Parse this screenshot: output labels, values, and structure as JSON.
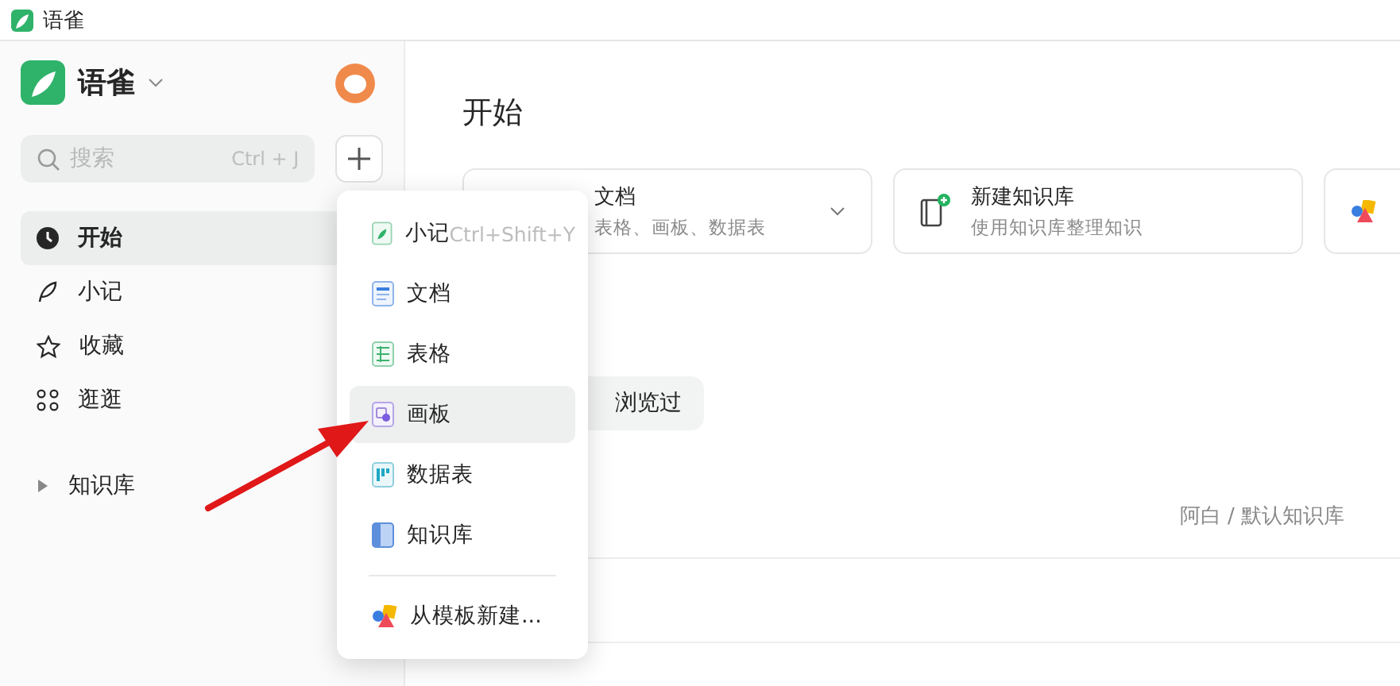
{
  "window": {
    "title": "语雀"
  },
  "sidebar": {
    "brand": "语雀",
    "search": {
      "placeholder": "搜索",
      "shortcut": "Ctrl + J"
    },
    "nav": [
      {
        "label": "开始",
        "selected": true
      },
      {
        "label": "小记",
        "selected": false
      },
      {
        "label": "收藏",
        "selected": false
      },
      {
        "label": "逛逛",
        "selected": false
      }
    ],
    "library": {
      "label": "知识库",
      "expanded": false
    }
  },
  "new_menu": [
    {
      "label": "小记",
      "kind": "note",
      "shortcut": "Ctrl+Shift+Y",
      "selected": false
    },
    {
      "label": "文档",
      "kind": "doc",
      "selected": false
    },
    {
      "label": "表格",
      "kind": "sheet",
      "selected": false
    },
    {
      "label": "画板",
      "kind": "board",
      "selected": true
    },
    {
      "label": "数据表",
      "kind": "table",
      "selected": false
    },
    {
      "label": "知识库",
      "kind": "book",
      "selected": false
    },
    {
      "label": "从模板新建...",
      "kind": "template",
      "selected": false
    }
  ],
  "main": {
    "title": "开始",
    "cards": [
      {
        "kind": "doc",
        "title": "文档",
        "subtitle": "表格、画板、数据表"
      },
      {
        "kind": "book",
        "title": "新建知识库",
        "subtitle": "使用知识库整理知识"
      },
      {
        "kind": "template"
      }
    ],
    "tabs": [
      {
        "label": "浏览过",
        "selected": false
      }
    ],
    "rows": [
      {
        "location": "阿白 / 默认知识库"
      },
      {}
    ]
  }
}
